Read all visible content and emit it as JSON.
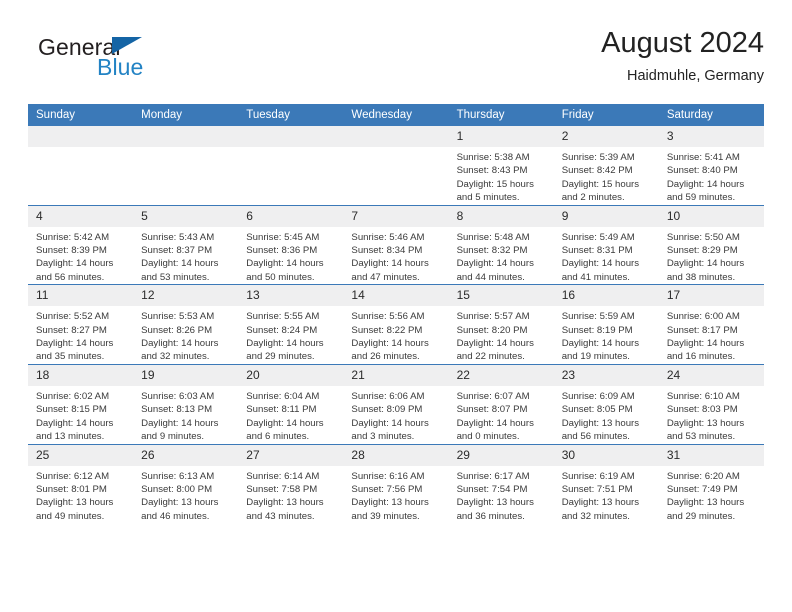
{
  "logo": {
    "word1": "General",
    "word2": "Blue",
    "triangle_color": "#1464a5",
    "word1_color": "#231f20",
    "word2_color": "#2383c4",
    "icon": "triangle-icon"
  },
  "header": {
    "title": "August 2024",
    "subtitle": "Haidmuhle, Germany"
  },
  "theme": {
    "header_blue": "#3b79b8",
    "daynum_gray": "#efeff0",
    "text": "#2b2b2b"
  },
  "calendar": {
    "weekday_headers": [
      "Sunday",
      "Monday",
      "Tuesday",
      "Wednesday",
      "Thursday",
      "Friday",
      "Saturday"
    ],
    "weeks": [
      [
        {
          "day": "",
          "blank": true
        },
        {
          "day": "",
          "blank": true
        },
        {
          "day": "",
          "blank": true
        },
        {
          "day": "",
          "blank": true
        },
        {
          "day": "1",
          "sunrise": "Sunrise: 5:38 AM",
          "sunset": "Sunset: 8:43 PM",
          "daylight": "Daylight: 15 hours and 5 minutes."
        },
        {
          "day": "2",
          "sunrise": "Sunrise: 5:39 AM",
          "sunset": "Sunset: 8:42 PM",
          "daylight": "Daylight: 15 hours and 2 minutes."
        },
        {
          "day": "3",
          "sunrise": "Sunrise: 5:41 AM",
          "sunset": "Sunset: 8:40 PM",
          "daylight": "Daylight: 14 hours and 59 minutes."
        }
      ],
      [
        {
          "day": "4",
          "sunrise": "Sunrise: 5:42 AM",
          "sunset": "Sunset: 8:39 PM",
          "daylight": "Daylight: 14 hours and 56 minutes."
        },
        {
          "day": "5",
          "sunrise": "Sunrise: 5:43 AM",
          "sunset": "Sunset: 8:37 PM",
          "daylight": "Daylight: 14 hours and 53 minutes."
        },
        {
          "day": "6",
          "sunrise": "Sunrise: 5:45 AM",
          "sunset": "Sunset: 8:36 PM",
          "daylight": "Daylight: 14 hours and 50 minutes."
        },
        {
          "day": "7",
          "sunrise": "Sunrise: 5:46 AM",
          "sunset": "Sunset: 8:34 PM",
          "daylight": "Daylight: 14 hours and 47 minutes."
        },
        {
          "day": "8",
          "sunrise": "Sunrise: 5:48 AM",
          "sunset": "Sunset: 8:32 PM",
          "daylight": "Daylight: 14 hours and 44 minutes."
        },
        {
          "day": "9",
          "sunrise": "Sunrise: 5:49 AM",
          "sunset": "Sunset: 8:31 PM",
          "daylight": "Daylight: 14 hours and 41 minutes."
        },
        {
          "day": "10",
          "sunrise": "Sunrise: 5:50 AM",
          "sunset": "Sunset: 8:29 PM",
          "daylight": "Daylight: 14 hours and 38 minutes."
        }
      ],
      [
        {
          "day": "11",
          "sunrise": "Sunrise: 5:52 AM",
          "sunset": "Sunset: 8:27 PM",
          "daylight": "Daylight: 14 hours and 35 minutes."
        },
        {
          "day": "12",
          "sunrise": "Sunrise: 5:53 AM",
          "sunset": "Sunset: 8:26 PM",
          "daylight": "Daylight: 14 hours and 32 minutes."
        },
        {
          "day": "13",
          "sunrise": "Sunrise: 5:55 AM",
          "sunset": "Sunset: 8:24 PM",
          "daylight": "Daylight: 14 hours and 29 minutes."
        },
        {
          "day": "14",
          "sunrise": "Sunrise: 5:56 AM",
          "sunset": "Sunset: 8:22 PM",
          "daylight": "Daylight: 14 hours and 26 minutes."
        },
        {
          "day": "15",
          "sunrise": "Sunrise: 5:57 AM",
          "sunset": "Sunset: 8:20 PM",
          "daylight": "Daylight: 14 hours and 22 minutes."
        },
        {
          "day": "16",
          "sunrise": "Sunrise: 5:59 AM",
          "sunset": "Sunset: 8:19 PM",
          "daylight": "Daylight: 14 hours and 19 minutes."
        },
        {
          "day": "17",
          "sunrise": "Sunrise: 6:00 AM",
          "sunset": "Sunset: 8:17 PM",
          "daylight": "Daylight: 14 hours and 16 minutes."
        }
      ],
      [
        {
          "day": "18",
          "sunrise": "Sunrise: 6:02 AM",
          "sunset": "Sunset: 8:15 PM",
          "daylight": "Daylight: 14 hours and 13 minutes."
        },
        {
          "day": "19",
          "sunrise": "Sunrise: 6:03 AM",
          "sunset": "Sunset: 8:13 PM",
          "daylight": "Daylight: 14 hours and 9 minutes."
        },
        {
          "day": "20",
          "sunrise": "Sunrise: 6:04 AM",
          "sunset": "Sunset: 8:11 PM",
          "daylight": "Daylight: 14 hours and 6 minutes."
        },
        {
          "day": "21",
          "sunrise": "Sunrise: 6:06 AM",
          "sunset": "Sunset: 8:09 PM",
          "daylight": "Daylight: 14 hours and 3 minutes."
        },
        {
          "day": "22",
          "sunrise": "Sunrise: 6:07 AM",
          "sunset": "Sunset: 8:07 PM",
          "daylight": "Daylight: 14 hours and 0 minutes."
        },
        {
          "day": "23",
          "sunrise": "Sunrise: 6:09 AM",
          "sunset": "Sunset: 8:05 PM",
          "daylight": "Daylight: 13 hours and 56 minutes."
        },
        {
          "day": "24",
          "sunrise": "Sunrise: 6:10 AM",
          "sunset": "Sunset: 8:03 PM",
          "daylight": "Daylight: 13 hours and 53 minutes."
        }
      ],
      [
        {
          "day": "25",
          "sunrise": "Sunrise: 6:12 AM",
          "sunset": "Sunset: 8:01 PM",
          "daylight": "Daylight: 13 hours and 49 minutes."
        },
        {
          "day": "26",
          "sunrise": "Sunrise: 6:13 AM",
          "sunset": "Sunset: 8:00 PM",
          "daylight": "Daylight: 13 hours and 46 minutes."
        },
        {
          "day": "27",
          "sunrise": "Sunrise: 6:14 AM",
          "sunset": "Sunset: 7:58 PM",
          "daylight": "Daylight: 13 hours and 43 minutes."
        },
        {
          "day": "28",
          "sunrise": "Sunrise: 6:16 AM",
          "sunset": "Sunset: 7:56 PM",
          "daylight": "Daylight: 13 hours and 39 minutes."
        },
        {
          "day": "29",
          "sunrise": "Sunrise: 6:17 AM",
          "sunset": "Sunset: 7:54 PM",
          "daylight": "Daylight: 13 hours and 36 minutes."
        },
        {
          "day": "30",
          "sunrise": "Sunrise: 6:19 AM",
          "sunset": "Sunset: 7:51 PM",
          "daylight": "Daylight: 13 hours and 32 minutes."
        },
        {
          "day": "31",
          "sunrise": "Sunrise: 6:20 AM",
          "sunset": "Sunset: 7:49 PM",
          "daylight": "Daylight: 13 hours and 29 minutes."
        }
      ]
    ]
  }
}
